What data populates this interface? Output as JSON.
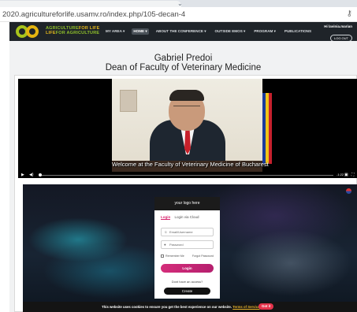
{
  "browser": {
    "url": "2020.agricultureforlife.usamv.ro/index.php/105-decan-4",
    "key_icon": "key-icon",
    "tab_chevron": "chevron-down-icon"
  },
  "site_nav": {
    "logo_line1_a": "AGRICULTURE",
    "logo_line1_b": "FOR LIFE",
    "logo_line2_a": "LIFE",
    "logo_line2_b": "FOR AGRICULTURE",
    "menu": [
      {
        "label": "MY AREA ▾"
      },
      {
        "label": "HOME ▾"
      },
      {
        "label": "ABOUT THE CONFERENCE ▾"
      },
      {
        "label": "OUTSIDE EMOS ▾"
      },
      {
        "label": "PROGRAM ▾"
      },
      {
        "label": "PUBLICATIONS"
      }
    ],
    "greeting": "Hi lavinia.marian",
    "logout": "LOG OUT"
  },
  "speaker": {
    "name": "Gabriel Predoi",
    "title": "Dean of Faculty of Veterinary Medicine"
  },
  "video": {
    "subtitle": "Welcome at the Faculty of Veterinary Medicine of Bucharest",
    "time": "-1:22",
    "play_icon": "play-icon",
    "volume_icon": "volume-icon",
    "cc_icon": "captions-icon",
    "fullscreen_icon": "fullscreen-icon"
  },
  "login": {
    "header": "your logo here",
    "tab_login": "Login",
    "tab_cloud": "Login via Cloud",
    "email_placeholder": "Email/Username",
    "password_placeholder": "Password",
    "remember": "Remember Me",
    "forgot": "Forgot Password",
    "login_button": "Login",
    "no_account": "Dont have an access?",
    "create_button": "Create"
  },
  "cookie": {
    "message": "This website uses cookies to ensure you get the best experience on our website.",
    "link": "Terms of Service",
    "button": "Got it"
  },
  "colors": {
    "nav_bg": "#1f2429",
    "accent_pink": "#d42d7a",
    "logo_green": "#8fbf2a",
    "logo_yellow": "#e3b71b"
  }
}
